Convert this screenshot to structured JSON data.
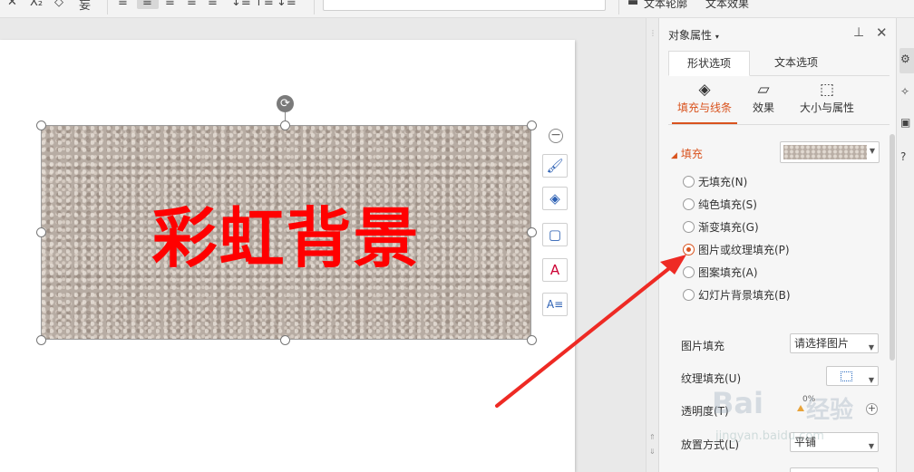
{
  "toolbar": {
    "glyphs": [
      "✕",
      "X₂",
      "◇",
      "妄",
      "≡",
      "≡",
      "≡",
      "≡",
      "↓≡",
      "↑≡",
      "↓≡"
    ],
    "text_outline_label": "文本轮廓",
    "text_effect_label": "文本效果"
  },
  "slide": {
    "shape_text": "彩虹背景",
    "shape_text_color": "#ff0000",
    "rotate_icon": "⟳",
    "float_tools": [
      {
        "name": "collapse",
        "glyph": "−"
      },
      {
        "name": "brush-style",
        "glyph": "🖌"
      },
      {
        "name": "fill",
        "glyph": "◈"
      },
      {
        "name": "outline",
        "glyph": "▢"
      },
      {
        "name": "text-fill",
        "glyph": "A"
      },
      {
        "name": "text-box",
        "glyph": "A≡"
      }
    ]
  },
  "panel": {
    "title": "对象属性",
    "title_caret": "▾",
    "pin_icon": "⊥",
    "close_icon": "✕",
    "tabs": [
      {
        "label": "形状选项",
        "active": true
      },
      {
        "label": "文本选项",
        "active": false
      }
    ],
    "subtabs": [
      {
        "label": "填充与线条",
        "icon": "◈",
        "active": true
      },
      {
        "label": "效果",
        "icon": "▱",
        "active": false
      },
      {
        "label": "大小与属性",
        "icon": "⬚",
        "active": false
      }
    ],
    "fill_section": {
      "title": "填充",
      "options": [
        {
          "label": "无填充(N)",
          "checked": false
        },
        {
          "label": "纯色填充(S)",
          "checked": false
        },
        {
          "label": "渐变填充(G)",
          "checked": false
        },
        {
          "label": "图片或纹理填充(P)",
          "checked": true
        },
        {
          "label": "图案填充(A)",
          "checked": false
        },
        {
          "label": "幻灯片背景填充(B)",
          "checked": false
        }
      ]
    },
    "picture_fill_label": "图片填充",
    "picture_fill_value": "请选择图片",
    "texture_fill_label": "纹理填充(U)",
    "transparency_label": "透明度(T)",
    "transparency_value": "0%",
    "placement_label": "放置方式(L)",
    "placement_value": "平铺"
  },
  "colors": {
    "accent": "#d9531e",
    "arrow": "#ee2a24"
  },
  "watermark": {
    "logo": "Bai",
    "cn": "经验",
    "url": "jingyan.baidu.com"
  }
}
